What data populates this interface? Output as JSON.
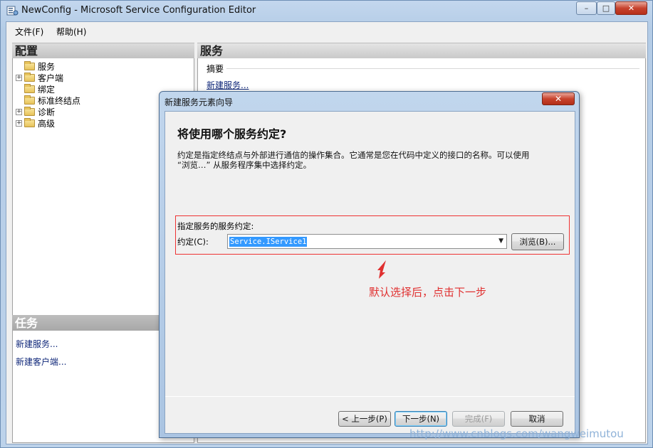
{
  "window": {
    "title": "NewConfig - Microsoft Service Configuration Editor",
    "minimize": "–",
    "maximize": "□",
    "close": "✕"
  },
  "menu": [
    {
      "label": "文件(F)"
    },
    {
      "label": "帮助(H)"
    }
  ],
  "config_pane": {
    "title": "配置",
    "tree": [
      {
        "label": "服务",
        "expander": "",
        "icon": "open-folder-icon"
      },
      {
        "label": "客户端",
        "expander": "+",
        "icon": "folder-icon"
      },
      {
        "label": "绑定",
        "expander": "",
        "icon": "folder-icon"
      },
      {
        "label": "标准终结点",
        "expander": "",
        "icon": "folder-icon"
      },
      {
        "label": "诊断",
        "expander": "+",
        "icon": "folder-icon"
      },
      {
        "label": "高级",
        "expander": "+",
        "icon": "folder-icon"
      }
    ]
  },
  "task_pane": {
    "title": "任务",
    "links": [
      "新建服务...",
      "新建客户端..."
    ]
  },
  "service_pane": {
    "title": "服务",
    "summary_label": "摘要",
    "new_service_link": "新建服务..."
  },
  "dialog": {
    "title": "新建服务元素向导",
    "question": "将使用哪个服务约定?",
    "description_line1": "约定是指定终结点与外部进行通信的操作集合。它通常是您在代码中定义的接口的名称。可以使用",
    "description_line2": "“浏览…” 从服务程序集中选择约定。",
    "spec_label": "指定服务的服务约定:",
    "contract_label": "约定(C):",
    "contract_value": "Service.IService1",
    "browse_button": "浏览(B)...",
    "prev_button": "< 上一步(P)",
    "next_button": "下一步(N)",
    "finish_button": "完成(F)",
    "cancel_button": "取消"
  },
  "annotation": {
    "text": "默认选择后，点击下一步",
    "color": "#e03030"
  },
  "watermark": "http://www.cnblogs.com/wangweimutou",
  "colors": {
    "highlight_box": "#ee3333",
    "selection": "#3399ff",
    "link": "#10287a"
  }
}
